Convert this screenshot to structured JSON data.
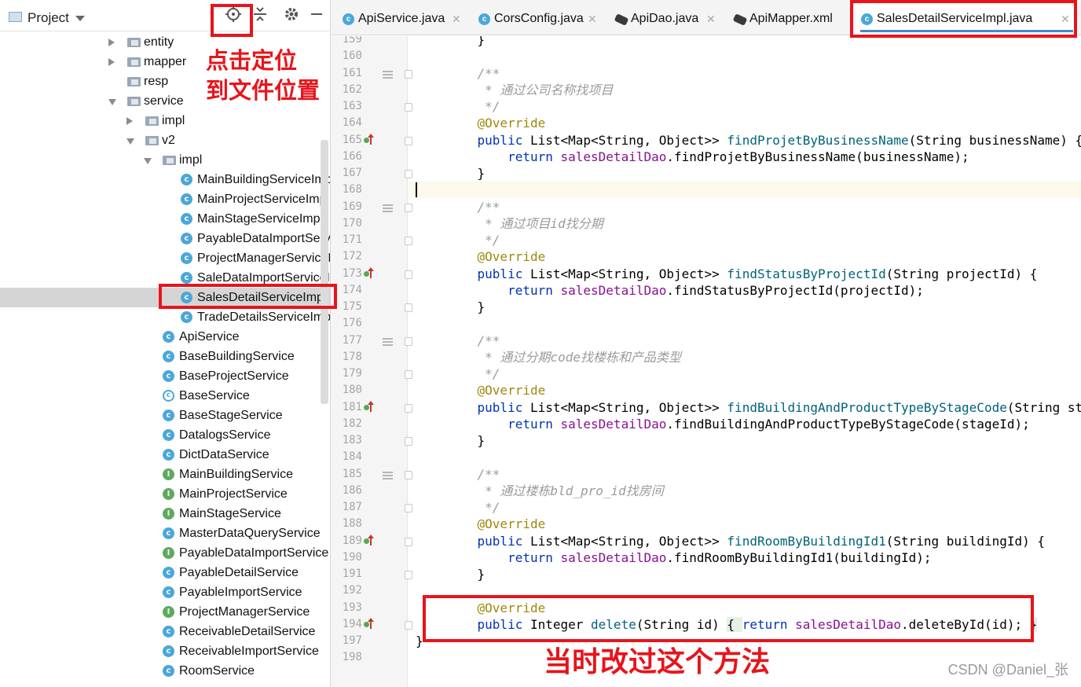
{
  "project_panel": {
    "title": "Project",
    "tree": [
      {
        "label": "entity",
        "type": "folder",
        "arrow": "right",
        "indent": 0
      },
      {
        "label": "mapper",
        "type": "folder",
        "arrow": "right",
        "indent": 0
      },
      {
        "label": "resp",
        "type": "folder",
        "arrow": "none",
        "indent": 0
      },
      {
        "label": "service",
        "type": "folder",
        "arrow": "down",
        "indent": 0
      },
      {
        "label": "impl",
        "type": "folder",
        "arrow": "right",
        "indent": 1
      },
      {
        "label": "v2",
        "type": "folder",
        "arrow": "down",
        "indent": 1
      },
      {
        "label": "impl",
        "type": "folder",
        "arrow": "down",
        "indent": 2
      },
      {
        "label": "MainBuildingServiceImpl",
        "type": "class",
        "indent": 3
      },
      {
        "label": "MainProjectServiceImpl",
        "type": "class",
        "indent": 3
      },
      {
        "label": "MainStageServiceImpl",
        "type": "class",
        "indent": 3
      },
      {
        "label": "PayableDataImportServiceImpl",
        "type": "class",
        "indent": 3
      },
      {
        "label": "ProjectManagerServiceImpl",
        "type": "class",
        "indent": 3
      },
      {
        "label": "SaleDataImportServiceImpl",
        "type": "class",
        "indent": 3
      },
      {
        "label": "SalesDetailServiceImpl",
        "type": "class",
        "indent": 3,
        "selected": true
      },
      {
        "label": "TradeDetailsServiceImpl",
        "type": "class",
        "indent": 3
      },
      {
        "label": "ApiService",
        "type": "class",
        "indent": 2
      },
      {
        "label": "BaseBuildingService",
        "type": "class",
        "indent": 2
      },
      {
        "label": "BaseProjectService",
        "type": "class",
        "indent": 2
      },
      {
        "label": "BaseService",
        "type": "abstract",
        "indent": 2
      },
      {
        "label": "BaseStageService",
        "type": "class",
        "indent": 2
      },
      {
        "label": "DatalogsService",
        "type": "class",
        "indent": 2
      },
      {
        "label": "DictDataService",
        "type": "class",
        "indent": 2
      },
      {
        "label": "MainBuildingService",
        "type": "interface",
        "indent": 2
      },
      {
        "label": "MainProjectService",
        "type": "interface",
        "indent": 2
      },
      {
        "label": "MainStageService",
        "type": "interface",
        "indent": 2
      },
      {
        "label": "MasterDataQueryService",
        "type": "class",
        "indent": 2
      },
      {
        "label": "PayableDataImportService",
        "type": "interface",
        "indent": 2
      },
      {
        "label": "PayableDetailService",
        "type": "class",
        "indent": 2
      },
      {
        "label": "PayableImportService",
        "type": "class",
        "indent": 2
      },
      {
        "label": "ProjectManagerService",
        "type": "interface",
        "indent": 2
      },
      {
        "label": "ReceivableDetailService",
        "type": "class",
        "indent": 2
      },
      {
        "label": "ReceivableImportService",
        "type": "class",
        "indent": 2
      },
      {
        "label": "RoomService",
        "type": "class",
        "indent": 2
      }
    ]
  },
  "tabs": [
    {
      "label": "ApiService.java",
      "icon": "class-icon",
      "active": false
    },
    {
      "label": "CorsConfig.java",
      "icon": "class-icon",
      "active": false
    },
    {
      "label": "ApiDao.java",
      "icon": "mybatis-icon",
      "active": false
    },
    {
      "label": "ApiMapper.xml",
      "icon": "mybatis-icon",
      "active": false
    },
    {
      "label": "SalesDetailServiceImpl.java",
      "icon": "class-icon",
      "active": true
    }
  ],
  "editor": {
    "current_line": 168,
    "lines": [
      {
        "n": 159,
        "code": "    }"
      },
      {
        "n": 160,
        "code": ""
      },
      {
        "n": 161,
        "code": "    /**",
        "cls": "cm",
        "fold": true,
        "lines": true
      },
      {
        "n": 162,
        "code": "     * 通过公司名称找项目",
        "cls": "cm"
      },
      {
        "n": 163,
        "code": "     */",
        "cls": "cm",
        "fold": true
      },
      {
        "n": 164,
        "code": "    @Override",
        "cls": "ann"
      },
      {
        "n": 165,
        "code": "",
        "rich": [
          [
            "    ",
            ""
          ],
          [
            "public ",
            "kw"
          ],
          [
            "List<Map<String, Object>> ",
            ""
          ],
          [
            "findProjetByBusinessName",
            "mcall"
          ],
          [
            "(String businessName) {",
            ""
          ]
        ],
        "mark": true,
        "fold": true
      },
      {
        "n": 166,
        "code": "",
        "rich": [
          [
            "        ",
            ""
          ],
          [
            "return ",
            "kw"
          ],
          [
            "salesDetailDao",
            "fld"
          ],
          [
            ".findProjetByBusinessName(businessName);",
            ""
          ]
        ]
      },
      {
        "n": 167,
        "code": "    }",
        "fold": true
      },
      {
        "n": 168,
        "code": "",
        "current": true
      },
      {
        "n": 169,
        "code": "    /**",
        "cls": "cm",
        "fold": true,
        "lines": true
      },
      {
        "n": 170,
        "code": "     * 通过项目id找分期",
        "cls": "cm"
      },
      {
        "n": 171,
        "code": "     */",
        "cls": "cm",
        "fold": true
      },
      {
        "n": 172,
        "code": "    @Override",
        "cls": "ann"
      },
      {
        "n": 173,
        "code": "",
        "rich": [
          [
            "    ",
            ""
          ],
          [
            "public ",
            "kw"
          ],
          [
            "List<Map<String, Object>> ",
            ""
          ],
          [
            "findStatusByProjectId",
            "mcall"
          ],
          [
            "(String projectId) {",
            ""
          ]
        ],
        "mark": true,
        "fold": true
      },
      {
        "n": 174,
        "code": "",
        "rich": [
          [
            "        ",
            ""
          ],
          [
            "return ",
            "kw"
          ],
          [
            "salesDetailDao",
            "fld"
          ],
          [
            ".findStatusByProjectId(projectId);",
            ""
          ]
        ]
      },
      {
        "n": 175,
        "code": "    }",
        "fold": true
      },
      {
        "n": 176,
        "code": ""
      },
      {
        "n": 177,
        "code": "    /**",
        "cls": "cm",
        "fold": true,
        "lines": true
      },
      {
        "n": 178,
        "code": "     * 通过分期code找楼栋和产品类型",
        "cls": "cm"
      },
      {
        "n": 179,
        "code": "     */",
        "cls": "cm",
        "fold": true
      },
      {
        "n": 180,
        "code": "    @Override",
        "cls": "ann"
      },
      {
        "n": 181,
        "code": "",
        "rich": [
          [
            "    ",
            ""
          ],
          [
            "public ",
            "kw"
          ],
          [
            "List<Map<String, Object>> ",
            ""
          ],
          [
            "findBuildingAndProductTypeByStageCode",
            "mcall"
          ],
          [
            "(String stageId) {",
            ""
          ]
        ],
        "mark": true,
        "fold": true
      },
      {
        "n": 182,
        "code": "",
        "rich": [
          [
            "        ",
            ""
          ],
          [
            "return ",
            "kw"
          ],
          [
            "salesDetailDao",
            "fld"
          ],
          [
            ".findBuildingAndProductTypeByStageCode(stageId);",
            ""
          ]
        ]
      },
      {
        "n": 183,
        "code": "    }",
        "fold": true
      },
      {
        "n": 184,
        "code": ""
      },
      {
        "n": 185,
        "code": "    /**",
        "cls": "cm",
        "fold": true,
        "lines": true
      },
      {
        "n": 186,
        "code": "     * 通过楼栋bld_pro_id找房间",
        "cls": "cm"
      },
      {
        "n": 187,
        "code": "     */",
        "cls": "cm",
        "fold": true
      },
      {
        "n": 188,
        "code": "    @Override",
        "cls": "ann"
      },
      {
        "n": 189,
        "code": "",
        "rich": [
          [
            "    ",
            ""
          ],
          [
            "public ",
            "kw"
          ],
          [
            "List<Map<String, Object>> ",
            ""
          ],
          [
            "findRoomByBuildingId1",
            "mcall"
          ],
          [
            "(String buildingId) {",
            ""
          ]
        ],
        "mark": true,
        "fold": true
      },
      {
        "n": 190,
        "code": "",
        "rich": [
          [
            "        ",
            ""
          ],
          [
            "return ",
            "kw"
          ],
          [
            "salesDetailDao",
            "fld"
          ],
          [
            ".findRoomByBuildingId1(buildingId);",
            ""
          ]
        ]
      },
      {
        "n": 191,
        "code": "    }",
        "fold": true
      },
      {
        "n": 192,
        "code": ""
      },
      {
        "n": 193,
        "code": "    @Override",
        "cls": "ann"
      },
      {
        "n": 194,
        "code": "",
        "rich": [
          [
            "    ",
            ""
          ],
          [
            "public ",
            "kw"
          ],
          [
            "Integer ",
            ""
          ],
          [
            "delete",
            "mcall"
          ],
          [
            "(String id) ",
            ""
          ],
          [
            "{ ",
            "brace"
          ],
          [
            "return ",
            "kw"
          ],
          [
            "salesDetailDao",
            "fld"
          ],
          [
            ".deleteById(id); ",
            ""
          ],
          [
            "}",
            "brace"
          ]
        ],
        "mark": true,
        "fold": true
      },
      {
        "n": 197,
        "code": "}",
        "outdent": true
      },
      {
        "n": 198,
        "code": ""
      }
    ]
  },
  "annotations": {
    "locate_text": "点击定位\n到文件位置",
    "method_text": "当时改过这个方法",
    "watermark": "CSDN @Daniel_张",
    "color": "#e8141b"
  }
}
